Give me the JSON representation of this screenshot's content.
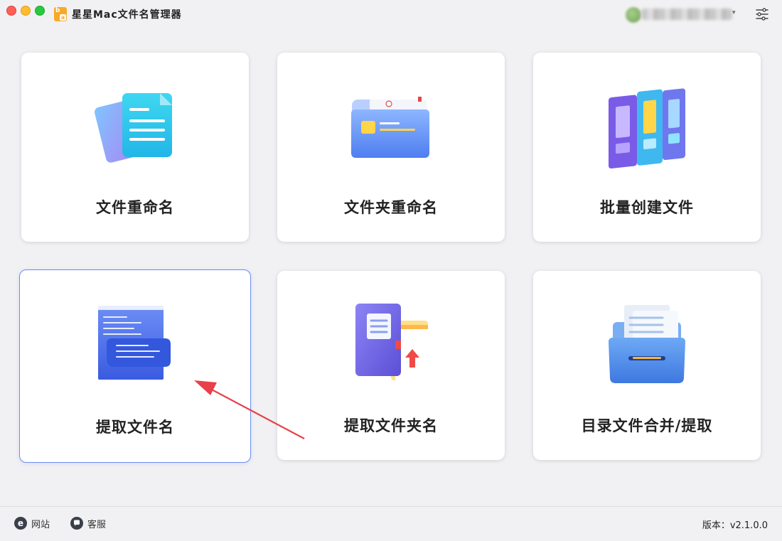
{
  "app": {
    "title": "星星Mac文件名管理器",
    "logo_top": "b",
    "logo_bottom": "a"
  },
  "cards": [
    {
      "label": "文件重命名",
      "icon": "documents-icon"
    },
    {
      "label": "文件夹重命名",
      "icon": "folder-icon"
    },
    {
      "label": "批量创建文件",
      "icon": "binders-icon"
    },
    {
      "label": "提取文件名",
      "icon": "scroll-icon"
    },
    {
      "label": "提取文件夹名",
      "icon": "notebook-icon"
    },
    {
      "label": "目录文件合并/提取",
      "icon": "file-drawer-icon"
    }
  ],
  "footer": {
    "website_label": "网站",
    "website_icon_glyph": "e",
    "support_label": "客服",
    "version": "版本：v2.1.0.0"
  },
  "colors": {
    "accent": "#6b8df0",
    "arrow": "#e8414a",
    "background": "#f1f1f3"
  }
}
